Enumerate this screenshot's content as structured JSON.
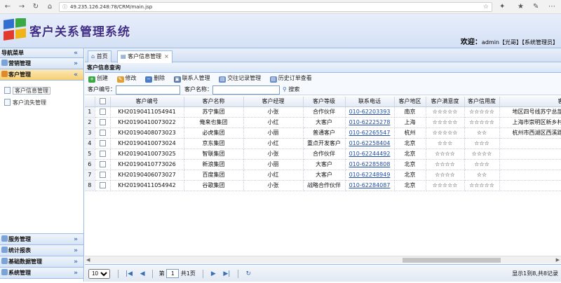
{
  "browser": {
    "url": "49.235.126.248:78/CRM/main.jsp"
  },
  "header": {
    "title": "客户关系管理系统",
    "welcome_prefix": "欢迎：",
    "welcome_user": "admin【光哥】【系统管理员】"
  },
  "sidebar": {
    "title": "导航菜单",
    "sections_top": [
      {
        "label": "营销管理"
      },
      {
        "label": "客户管理"
      }
    ],
    "links": [
      {
        "label": "客户信息管理"
      },
      {
        "label": "客户流失管理"
      }
    ],
    "sections_bottom": [
      {
        "label": "服务管理"
      },
      {
        "label": "统计报表"
      },
      {
        "label": "基础数据管理"
      },
      {
        "label": "系统管理"
      }
    ]
  },
  "tabs": [
    {
      "label": "首页"
    },
    {
      "label": "客户信息管理"
    }
  ],
  "panel": {
    "title": "客户信息查询"
  },
  "toolbar": {
    "create": "创建",
    "edit": "修改",
    "delete": "删除",
    "contacts": "联系人管理",
    "records": "交往记录管理",
    "orders": "历史订单查看"
  },
  "search": {
    "code_label": "客户编号：",
    "name_label": "客户名称：",
    "button": "搜索"
  },
  "grid": {
    "columns": [
      "客户编号",
      "客户名称",
      "客户经理",
      "客户等级",
      "联系电话",
      "客户地区",
      "客户满意度",
      "客户信用度",
      "客户地址"
    ],
    "rows": [
      {
        "no": "1",
        "code": "KH20190411054941",
        "name": "苏宁集团",
        "manager": "小张",
        "level": "合作伙伴",
        "phone": "010-62203393",
        "region": "南京",
        "satisfaction": "☆☆☆☆☆",
        "credit": "☆☆☆☆☆",
        "address": "地区四号线苏宁总部"
      },
      {
        "no": "2",
        "code": "KH20190410073022",
        "name": "俺来也集团",
        "manager": "小红",
        "level": "大客户",
        "phone": "010-62225278",
        "region": "上海",
        "satisfaction": "☆☆☆☆☆",
        "credit": "☆☆☆☆☆",
        "address": "上海市崇明区新乡村"
      },
      {
        "no": "3",
        "code": "KH20190408073023",
        "name": "必虎集团",
        "manager": "小丽",
        "level": "普通客户",
        "phone": "010-62265547",
        "region": "杭州",
        "satisfaction": "☆☆☆☆☆",
        "credit": "☆☆",
        "address": "杭州市西湖区西溪路"
      },
      {
        "no": "4",
        "code": "KH20190410073024",
        "name": "京东集团",
        "manager": "小红",
        "level": "重点开发客户",
        "phone": "010-62258404",
        "region": "北京",
        "satisfaction": "☆☆☆",
        "credit": "☆☆☆",
        "address": ""
      },
      {
        "no": "5",
        "code": "KH20190410073025",
        "name": "智联集团",
        "manager": "小张",
        "level": "合作伙伴",
        "phone": "010-62244492",
        "region": "北京",
        "satisfaction": "☆☆☆☆",
        "credit": "☆☆☆☆",
        "address": ""
      },
      {
        "no": "6",
        "code": "KH20190410773026",
        "name": "新浪集团",
        "manager": "小丽",
        "level": "大客户",
        "phone": "010-62285808",
        "region": "北京",
        "satisfaction": "☆☆☆☆",
        "credit": "☆☆☆",
        "address": ""
      },
      {
        "no": "7",
        "code": "KH20190406073027",
        "name": "百度集团",
        "manager": "小红",
        "level": "大客户",
        "phone": "010-62248949",
        "region": "北京",
        "satisfaction": "☆☆☆☆",
        "credit": "☆☆",
        "address": ""
      },
      {
        "no": "8",
        "code": "KH20190411054942",
        "name": "谷歌集团",
        "manager": "小张",
        "level": "战略合作伙伴",
        "phone": "010-62284087",
        "region": "北京",
        "satisfaction": "☆☆☆☆☆",
        "credit": "☆☆☆☆☆",
        "address": ""
      }
    ]
  },
  "pager": {
    "page_size": "10",
    "page_prefix": "第",
    "page": "1",
    "page_suffix": "共1页",
    "info": "显示1到8,共8记录"
  }
}
